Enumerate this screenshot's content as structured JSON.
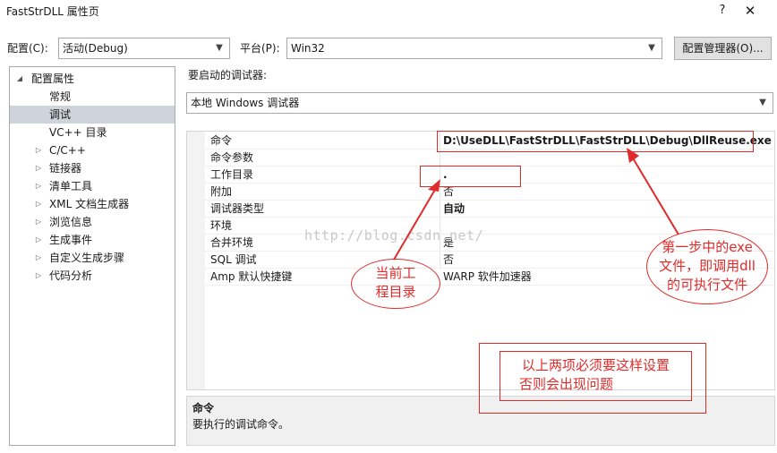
{
  "window": {
    "title": "FastStrDLL 属性页",
    "help_label": "?",
    "close_label": "✕"
  },
  "toolbar": {
    "config_label": "配置(C):",
    "config_value": "活动(Debug)",
    "platform_label": "平台(P):",
    "platform_value": "Win32",
    "config_manager_label": "配置管理器(O)..."
  },
  "tree": {
    "items": [
      {
        "label": "配置属性",
        "arrow": "◢"
      },
      {
        "label": "常规",
        "arrow": ""
      },
      {
        "label": "调试",
        "arrow": ""
      },
      {
        "label": "VC++ 目录",
        "arrow": ""
      },
      {
        "label": "C/C++",
        "arrow": "▷"
      },
      {
        "label": "链接器",
        "arrow": "▷"
      },
      {
        "label": "清单工具",
        "arrow": "▷"
      },
      {
        "label": "XML 文档生成器",
        "arrow": "▷"
      },
      {
        "label": "浏览信息",
        "arrow": "▷"
      },
      {
        "label": "生成事件",
        "arrow": "▷"
      },
      {
        "label": "自定义生成步骤",
        "arrow": "▷"
      },
      {
        "label": "代码分析",
        "arrow": "▷"
      }
    ]
  },
  "debugger": {
    "label": "要启动的调试器:",
    "value": "本地 Windows 调试器"
  },
  "grid": {
    "rows": [
      {
        "name": "命令",
        "value": "D:\\UseDLL\\FastStrDLL\\FastStrDLL\\Debug\\DllReuse.exe"
      },
      {
        "name": "命令参数",
        "value": ""
      },
      {
        "name": "工作目录",
        "value": "."
      },
      {
        "name": "附加",
        "value": "否"
      },
      {
        "name": "调试器类型",
        "value": "自动"
      },
      {
        "name": "环境",
        "value": ""
      },
      {
        "name": "合并环境",
        "value": "是"
      },
      {
        "name": "SQL 调试",
        "value": "否"
      },
      {
        "name": "Amp 默认快捷键",
        "value": "WARP 软件加速器"
      }
    ]
  },
  "description": {
    "title": "命令",
    "text": "要执行的调试命令。"
  },
  "watermark": "http://blog.csdn.net/",
  "annotations": {
    "workdir_note_1": "当前工",
    "workdir_note_2": "程目录",
    "exe_note_1": "第一步中的exe",
    "exe_note_2": "文件，即调用dll",
    "exe_note_3": "的可执行文件",
    "must_note_1": "以上两项必须要这样设置",
    "must_note_2": "否则会出现问题"
  },
  "colors": {
    "annotation_red": "#e02b2b",
    "selection": "#cfd3dc"
  }
}
